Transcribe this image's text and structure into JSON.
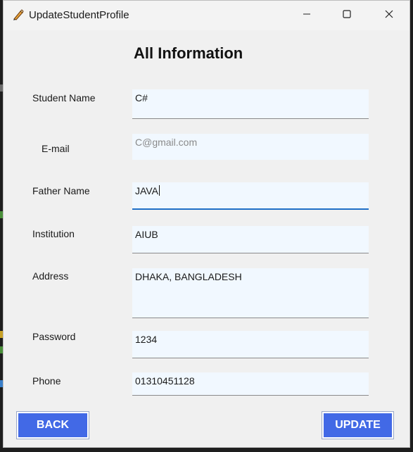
{
  "window": {
    "title": "UpdateStudentProfile"
  },
  "form": {
    "heading": "All Information",
    "fields": [
      {
        "label": "Student Name",
        "value": "C#"
      },
      {
        "label": "E-mail",
        "placeholder": "C@gmail.com"
      },
      {
        "label": "Father Name",
        "value": "JAVA"
      },
      {
        "label": "Institution",
        "value": "AIUB"
      },
      {
        "label": "Address",
        "value": "DHAKA, BANGLADESH"
      },
      {
        "label": "Password",
        "value": "1234"
      },
      {
        "label": "Phone",
        "value": "01310451128"
      }
    ]
  },
  "buttons": {
    "back": "BACK",
    "update": "UPDATE"
  },
  "colors": {
    "button_bg": "#4269e6",
    "field_bg": "#f1f8ff",
    "focus_underline": "#1f6fc7"
  },
  "icons": {
    "app": "pencil-feather-icon",
    "minimize": "minimize-icon",
    "maximize": "maximize-icon",
    "close": "close-icon"
  }
}
